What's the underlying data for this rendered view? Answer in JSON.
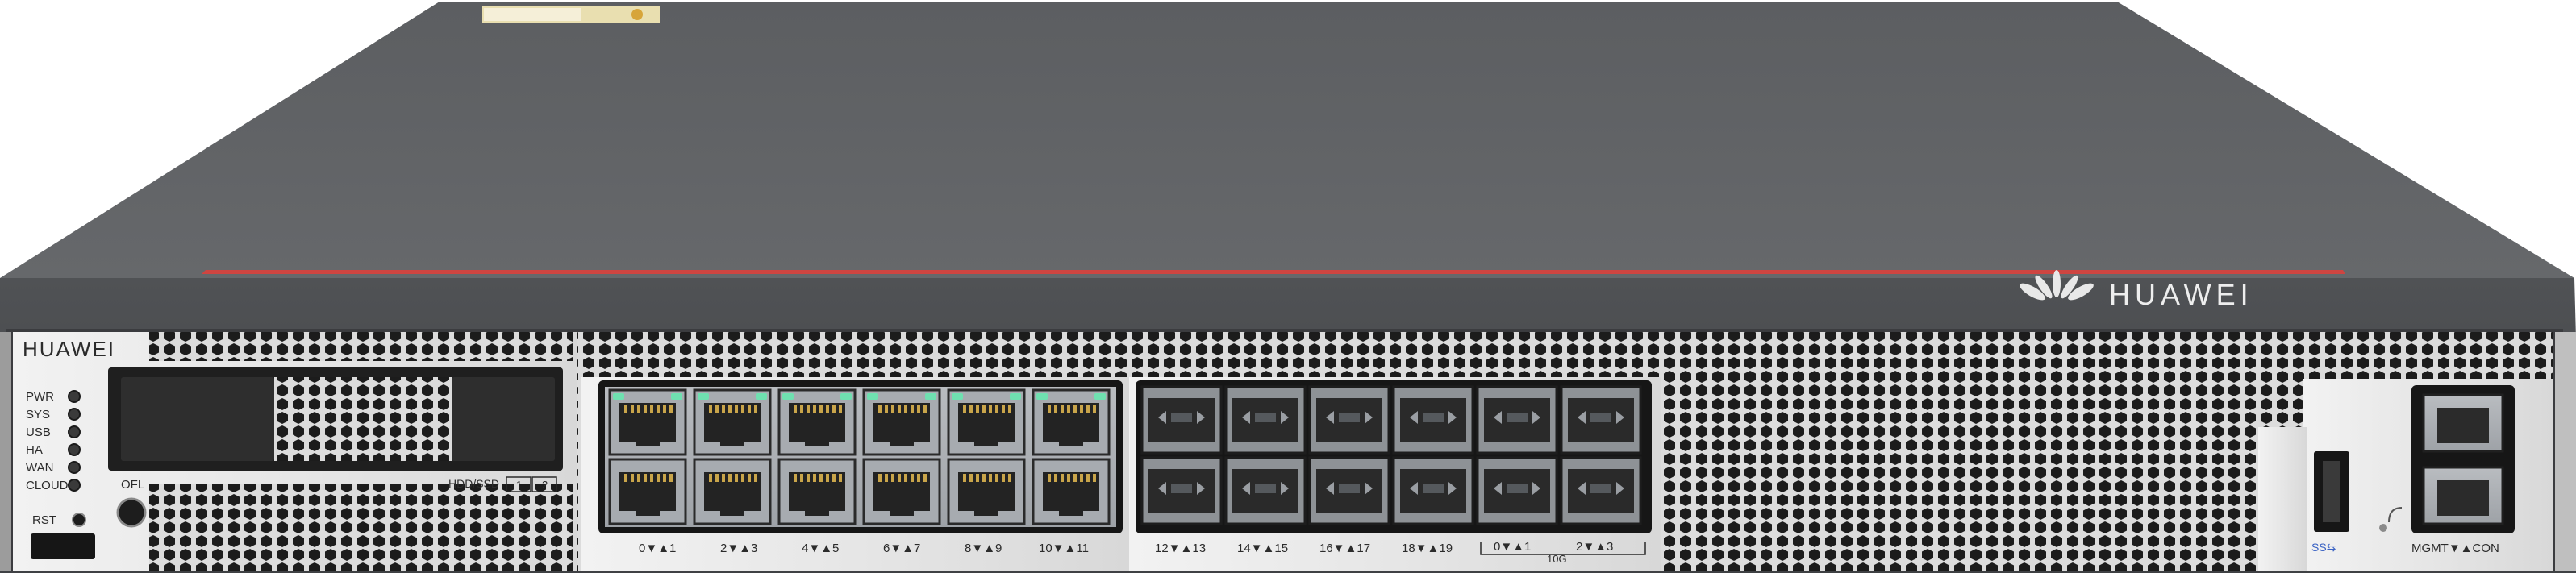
{
  "device": {
    "brand_front": "HUAWEI",
    "brand_side": "HUAWEI",
    "accent_stripe_color": "#e0403a",
    "chassis_color": "#5f6164",
    "led_color_active": "#6fe0b0"
  },
  "status_leds": {
    "labels": [
      "PWR",
      "SYS",
      "USB",
      "HA",
      "WAN",
      "CLOUD"
    ]
  },
  "controls": {
    "ofl_label": "OFL",
    "rst_label": "RST",
    "hdd_label": "HDD/SSD",
    "hdd_slots": [
      "1",
      "2"
    ]
  },
  "rj45_ports": {
    "pair_labels": [
      "0▼▲1",
      "2▼▲3",
      "4▼▲5",
      "6▼▲7",
      "8▼▲9",
      "10▼▲11"
    ]
  },
  "sfp_ports": {
    "pair_labels": [
      "12▼▲13",
      "14▼▲15",
      "16▼▲17",
      "18▼▲19"
    ]
  },
  "sfp10g_ports": {
    "pair_labels": [
      "0▼▲1",
      "2▼▲3"
    ],
    "speed_label": "10G"
  },
  "mgmt": {
    "label": "MGMT▼▲CON",
    "usb_label": "SS⇆"
  }
}
